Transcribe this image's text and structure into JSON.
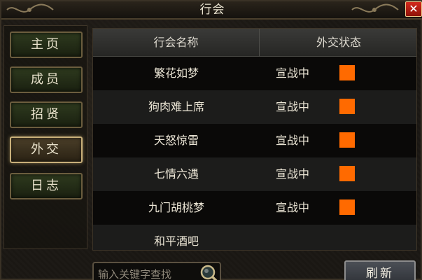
{
  "window": {
    "title": "行会",
    "close_label": "✕"
  },
  "nav": {
    "items": [
      {
        "label": "主页",
        "active": false
      },
      {
        "label": "成员",
        "active": false
      },
      {
        "label": "招贤",
        "active": false
      },
      {
        "label": "外交",
        "active": true
      },
      {
        "label": "日志",
        "active": false
      }
    ]
  },
  "table": {
    "headers": [
      "行会名称",
      "外交状态"
    ],
    "rows": [
      {
        "name": "繁花如梦",
        "status": "宣战中",
        "color": "#ff6a00"
      },
      {
        "name": "狗肉难上席",
        "status": "宣战中",
        "color": "#ff6a00"
      },
      {
        "name": "天怒惊雷",
        "status": "宣战中",
        "color": "#ff6a00"
      },
      {
        "name": "七情六遇",
        "status": "宣战中",
        "color": "#ff6a00"
      },
      {
        "name": "九门胡桃梦",
        "status": "宣战中",
        "color": "#ff6a00"
      },
      {
        "name": "和平酒吧",
        "status": "",
        "color": ""
      }
    ]
  },
  "search": {
    "placeholder": "输入关键字查找"
  },
  "refresh_label": "刷新"
}
